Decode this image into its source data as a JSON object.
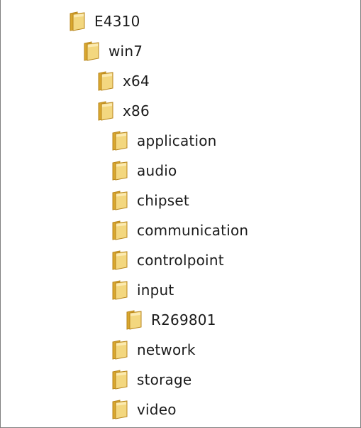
{
  "tree": {
    "nodes": [
      {
        "label": "E4310",
        "icon": "folder-icon"
      },
      {
        "label": "win7",
        "icon": "folder-icon"
      },
      {
        "label": "x64",
        "icon": "folder-icon"
      },
      {
        "label": "x86",
        "icon": "folder-icon"
      },
      {
        "label": "application",
        "icon": "folder-icon"
      },
      {
        "label": "audio",
        "icon": "folder-icon"
      },
      {
        "label": "chipset",
        "icon": "folder-icon"
      },
      {
        "label": "communication",
        "icon": "folder-icon"
      },
      {
        "label": "controlpoint",
        "icon": "folder-icon"
      },
      {
        "label": "input",
        "icon": "folder-icon"
      },
      {
        "label": "R269801",
        "icon": "folder-icon"
      },
      {
        "label": "network",
        "icon": "folder-icon"
      },
      {
        "label": "storage",
        "icon": "folder-icon"
      },
      {
        "label": "video",
        "icon": "folder-icon"
      }
    ]
  },
  "colors": {
    "folder_back": "#d9a72e",
    "folder_front": "#f3d77f",
    "folder_edge": "#b8861c",
    "border": "#7f7f7f"
  }
}
